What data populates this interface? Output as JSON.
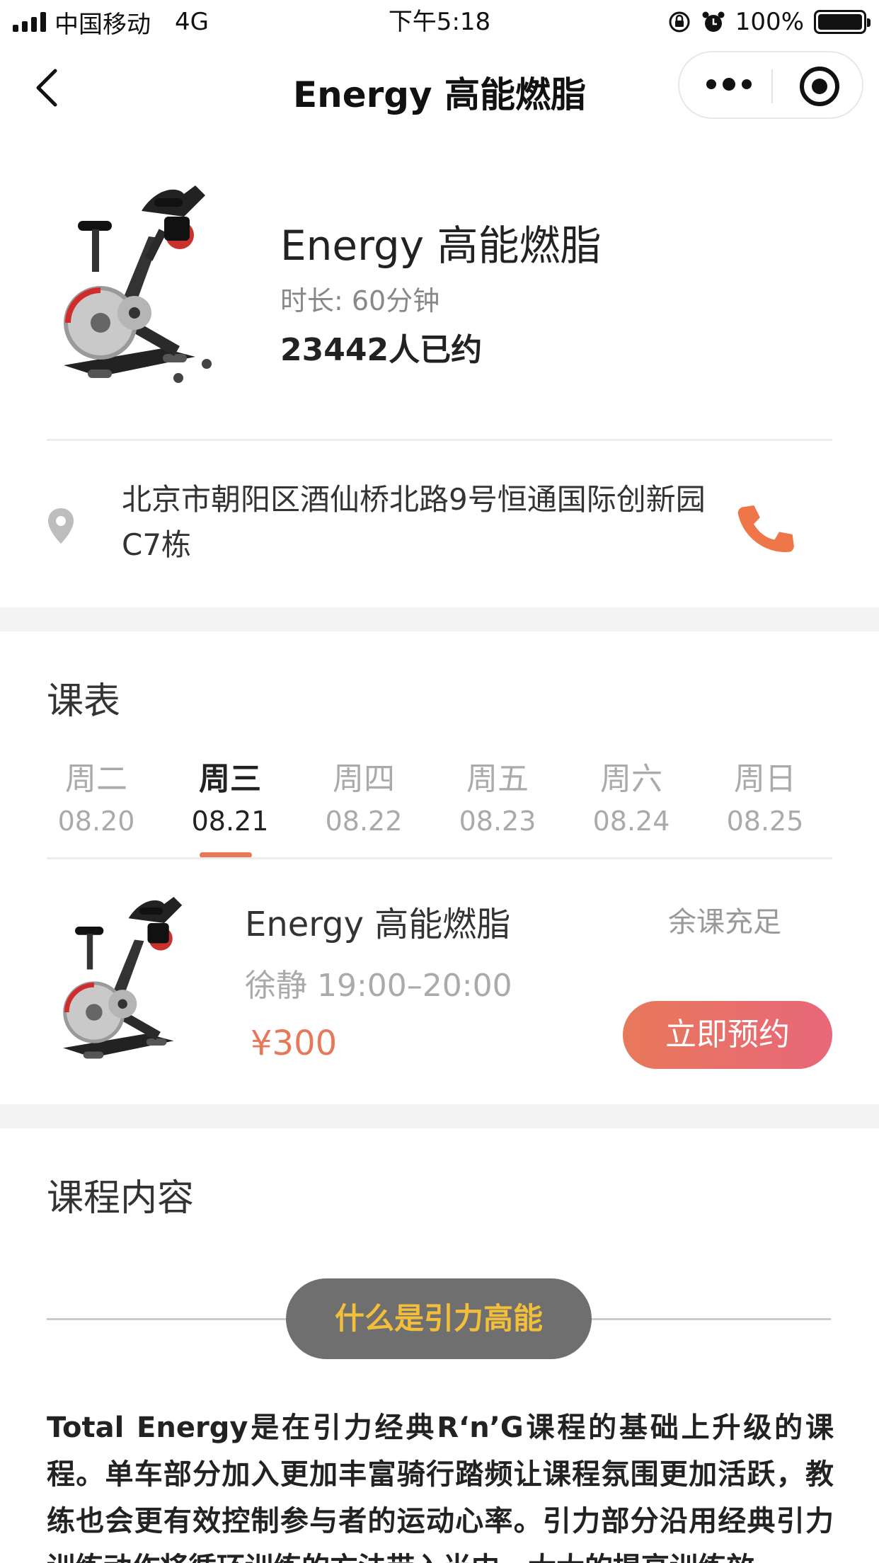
{
  "status_bar": {
    "carrier": "中国移动",
    "network": "4G",
    "time": "下午5:18",
    "battery_percent": "100%",
    "battery_level": 1.0
  },
  "nav": {
    "title": "Energy 高能燃脂",
    "back_icon": "chevron-left-icon",
    "more_icon": "more-dots-icon",
    "close_icon": "target-close-icon"
  },
  "course": {
    "title": "Energy 高能燃脂",
    "duration": "时长: 60分钟",
    "booked": "23442人已约",
    "image_icon": "spin-bike-image"
  },
  "location": {
    "address": "北京市朝阳区酒仙桥北路9号恒通国际创新园C7栋",
    "pin_icon": "location-pin-icon",
    "phone_icon": "phone-icon"
  },
  "schedule": {
    "title": "课表",
    "days": [
      {
        "name": "周二",
        "date": "08.20",
        "active": false
      },
      {
        "name": "周三",
        "date": "08.21",
        "active": true
      },
      {
        "name": "周四",
        "date": "08.22",
        "active": false
      },
      {
        "name": "周五",
        "date": "08.23",
        "active": false
      },
      {
        "name": "周六",
        "date": "08.24",
        "active": false
      },
      {
        "name": "周日",
        "date": "08.25",
        "active": false
      }
    ],
    "class": {
      "title": "Energy 高能燃脂",
      "coach_time": "徐静 19:00–20:00",
      "price": "¥300",
      "status": "余课充足",
      "book_label": "立即预约"
    }
  },
  "content": {
    "title": "课程内容",
    "pill_label": "什么是引力高能",
    "paragraph": "Total Energy是在引力经典R‘n’G课程的基础上升级的课程。单车部分加入更加丰富骑行踏频让课程氛围更加活跃，教练也会更有效控制参与者的运动心率。引力部分沿用经典引力训练动作将循环训练的方法带入当中，大大的提高训练效"
  },
  "colors": {
    "accent": "#e8785a",
    "button_gradient_end": "#e8677a",
    "pill_bg": "#6f6f6f",
    "pill_text": "#f3bf3a",
    "section_gap": "#f3f3f3"
  }
}
